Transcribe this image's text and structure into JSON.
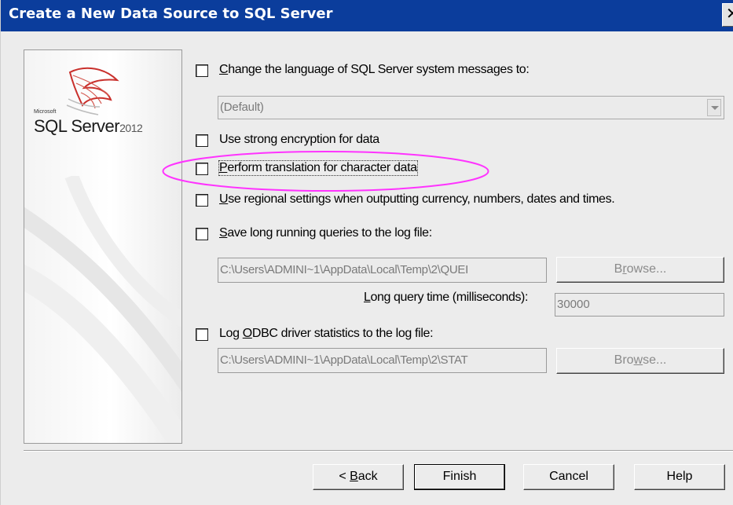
{
  "window": {
    "title": "Create a New Data Source to SQL Server",
    "close_glyph": "✕"
  },
  "logo": {
    "vendor": "Microsoft",
    "product": "SQL Server",
    "version": "2012"
  },
  "options": {
    "change_language": {
      "label_u": "C",
      "label_rest": "hange the language of SQL Server system messages to:",
      "checked": false
    },
    "language_select": {
      "value": "(Default)"
    },
    "strong_encryption": {
      "label_pre": "Use stron",
      "label_u": "g",
      "label_rest": " encryption for data",
      "checked": false
    },
    "translation": {
      "label_u": "P",
      "label_rest": "erform translation for character data",
      "checked": false
    },
    "regional": {
      "label_pre": "U",
      "label_u": "s",
      "label_rest": "e regional settings when outputting currency, numbers, dates and times.",
      "checked": false
    },
    "long_queries": {
      "label_u": "S",
      "label_rest": "ave long running queries to the log file:",
      "checked": false
    },
    "long_queries_path": "C:\\Users\\ADMINI~1\\AppData\\Local\\Temp\\2\\QUEI",
    "long_queries_browse": {
      "label_pre": "B",
      "label_u": "r",
      "label_rest": "owse..."
    },
    "long_query_time": {
      "label_u": "L",
      "label_rest": "ong query time (milliseconds):",
      "value": "30000"
    },
    "odbc_stats": {
      "label_pre": "Log ",
      "label_u": "O",
      "label_rest": "DBC driver statistics to the log file:",
      "checked": false
    },
    "odbc_stats_path": "C:\\Users\\ADMINI~1\\AppData\\Local\\Temp\\2\\STAT",
    "odbc_stats_browse": {
      "label_pre": "Bro",
      "label_u": "w",
      "label_rest": "se..."
    }
  },
  "buttons": {
    "back": {
      "label_pre": "< ",
      "label_u": "B",
      "label_rest": "ack"
    },
    "finish": "Finish",
    "cancel": "Cancel",
    "help": "Help"
  },
  "colors": {
    "titlebar": "#0b3d9c",
    "highlight_ellipse": "#ff33ff"
  }
}
